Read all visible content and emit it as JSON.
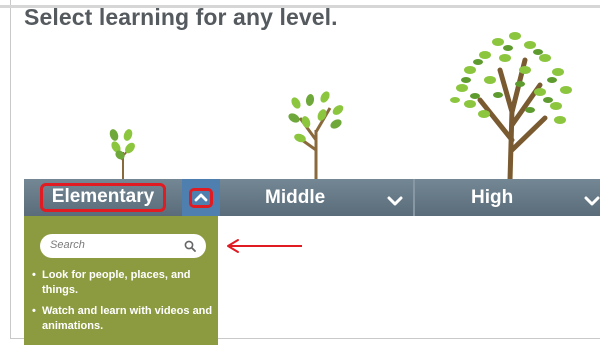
{
  "headline": "Select learning for any level.",
  "levels": [
    {
      "label": "Elementary",
      "expanded": true
    },
    {
      "label": "Middle",
      "expanded": false
    },
    {
      "label": "High",
      "expanded": false
    }
  ],
  "dropdown": {
    "search_placeholder": "Search",
    "bullets": [
      "Look for people, places, and things.",
      "Watch and learn with videos and animations."
    ]
  },
  "icons": {
    "collapse": "chevron-up-icon",
    "expand": "chevron-down-icon",
    "search": "search-icon",
    "annotation": "red-arrow-icon"
  },
  "colors": {
    "bar": "#667884",
    "active_toggle": "#4f7fae",
    "dropdown": "#8c9b40",
    "annotation": "#e01b22",
    "headline": "#555a5f",
    "leaf": "#8cc63f",
    "trunk": "#8a6a3c"
  }
}
